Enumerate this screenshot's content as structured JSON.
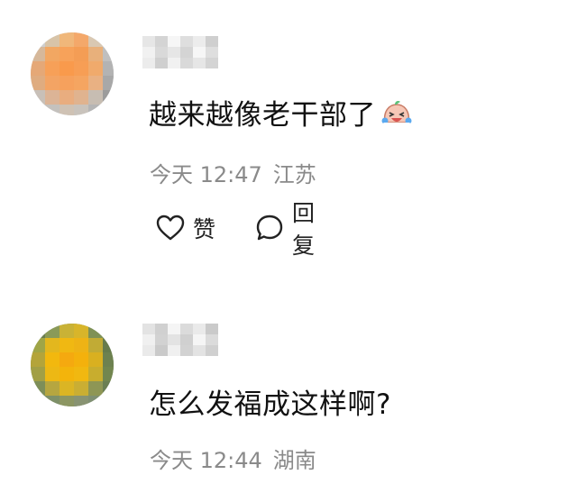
{
  "comments": [
    {
      "username": "",
      "text": "越来越像老干部了",
      "emoji": "crying-laughing-emoji",
      "time": "今天 12:47",
      "location": "江苏",
      "actions": {
        "like_label": "赞",
        "reply_label": "回复"
      }
    },
    {
      "username": "",
      "text": "怎么发福成这样啊?",
      "time": "今天 12:44",
      "location": "湖南"
    }
  ],
  "icons": {
    "like": "heart-outline-icon",
    "reply": "speech-bubble-icon"
  },
  "colors": {
    "text": "#111111",
    "meta": "#8a8a8a"
  }
}
